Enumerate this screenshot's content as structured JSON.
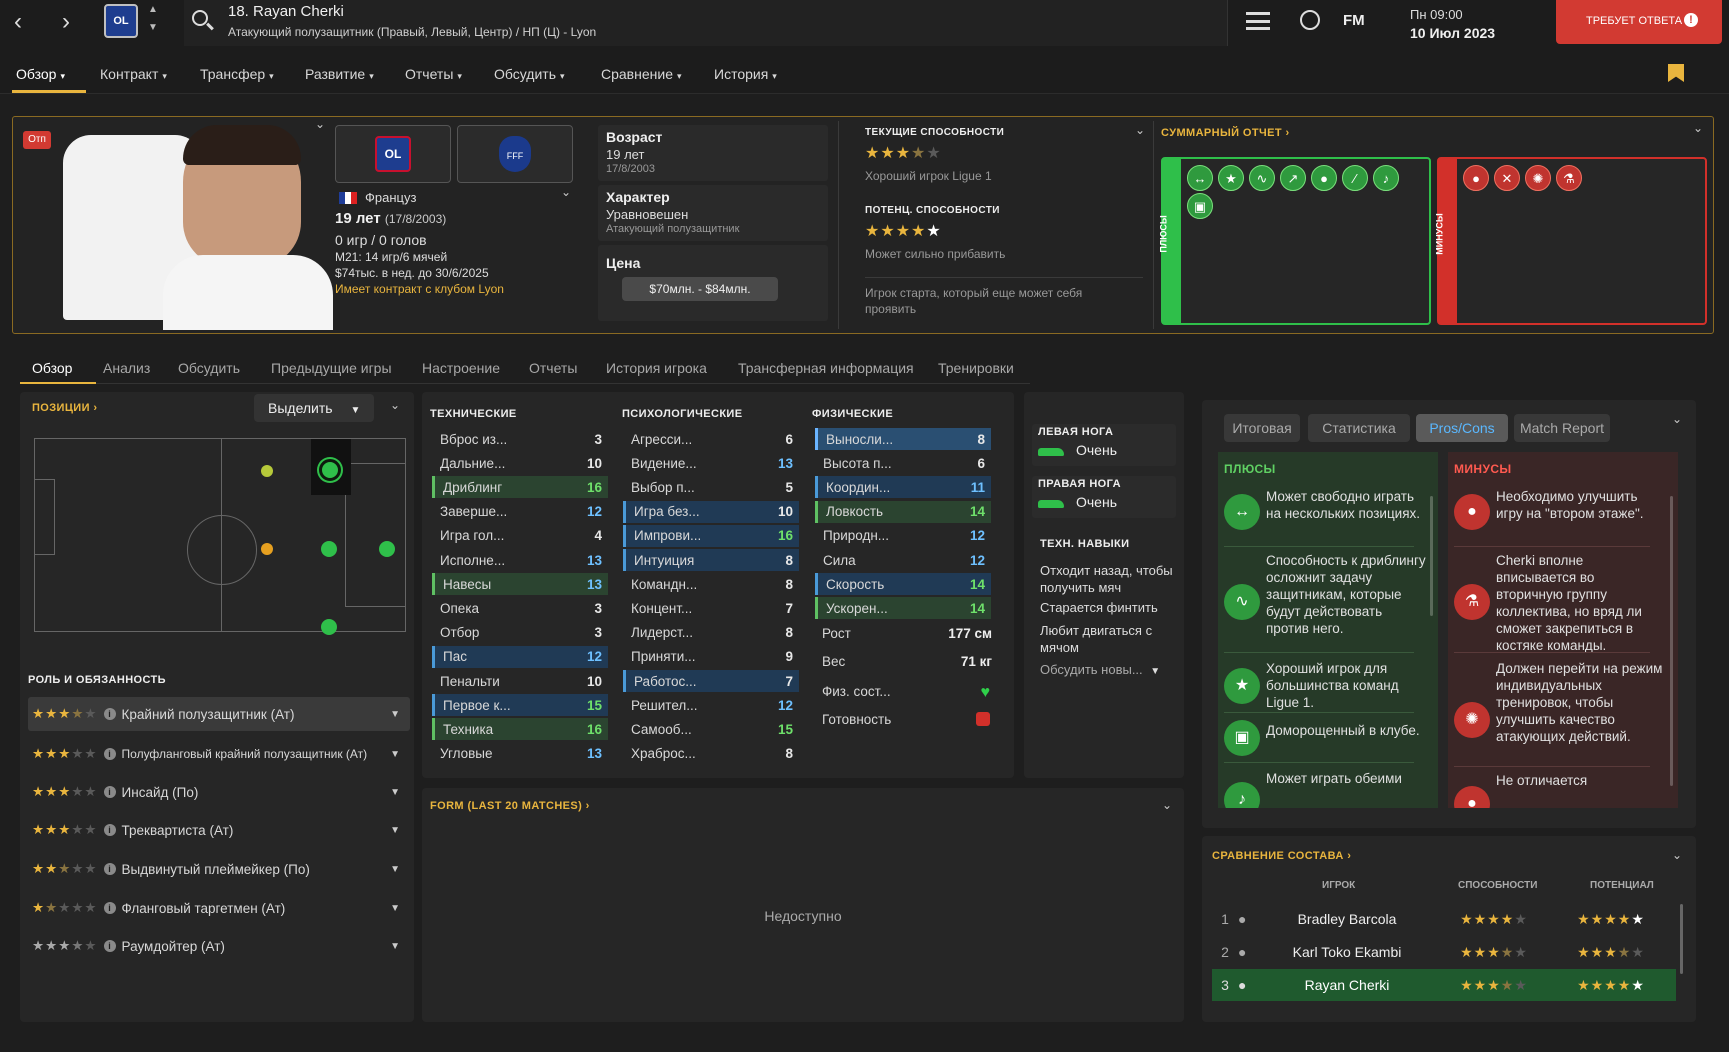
{
  "player": {
    "title": "18. Rayan Cherki",
    "subtitle": "Атакующий полузащитник (Правый, Левый, Центр) / НП (Ц) - Lyon",
    "nationality": "Француз",
    "age_line": "19 лет",
    "dob_paren": "(17/8/2003)",
    "games": "0 игр / 0 голов",
    "u21": "M21: 14 игр/6 мячей",
    "wage": "$74тыс. в нед. до 30/6/2025",
    "contract": "Имеет контракт с клубом Lyon",
    "loan_badge": "Отп",
    "club_badge": "OL",
    "nation_badge": "FFF"
  },
  "topbar": {
    "day_time": "Пн 09:00",
    "date": "10 Июл 2023",
    "fm_label": "FM",
    "alert_label": "ТРЕБУЕТ ОТВЕТА",
    "alert_mark": "!"
  },
  "nav": {
    "items": [
      "Обзор",
      "Контракт",
      "Трансфер",
      "Развитие",
      "Отчеты",
      "Обсудить",
      "Сравнение",
      "История"
    ]
  },
  "info": {
    "age_label": "Возраст",
    "age_value": "19 лет",
    "age_dob": "17/8/2003",
    "char_label": "Характер",
    "char_value": "Уравновешен",
    "char_role": "Атакующий полузащитник",
    "price_label": "Цена",
    "price_value": "$70млн. - $84млн."
  },
  "ability": {
    "ca_label": "ТЕКУЩИЕ СПОСОБНОСТИ",
    "ca_stars": 3.5,
    "ca_text": "Хороший игрок Ligue 1",
    "pa_label": "ПОТЕНЦ. СПОСОБНОСТИ",
    "pa_stars": 5,
    "pa_text": "Может сильно прибавить",
    "summary_text": "Игрок старта, который еще может себя проявить"
  },
  "summary": {
    "title": "СУММАРНЫЙ ОТЧЕТ",
    "plus_label": "ПЛЮСЫ",
    "minus_label": "МИНУСЫ",
    "plus_icons": 8,
    "minus_icons": 4
  },
  "subtabs": [
    "Обзор",
    "Анализ",
    "Обсудить",
    "Предыдущие игры",
    "Настроение",
    "Отчеты",
    "История игрока",
    "Трансферная информация",
    "Тренировки"
  ],
  "positions": {
    "title": "ПОЗИЦИИ",
    "highlight_label": "Выделить"
  },
  "roles": {
    "title": "РОЛЬ И ОБЯЗАННОСТЬ",
    "items": [
      {
        "name": "Крайний полузащитник (Ат)",
        "stars": 3.5
      },
      {
        "name": "Полуфланговый крайний полузащитник (Ат)",
        "stars": 3
      },
      {
        "name": "Инсайд (По)",
        "stars": 3
      },
      {
        "name": "Трекварти­ста (Ат)",
        "stars": 3
      },
      {
        "name": "Выдвинутый плеймейкер (По)",
        "stars": 2.5
      },
      {
        "name": "Фланговый таргетмен (Ат)",
        "stars": 1.5
      },
      {
        "name": "Раумдойтер (Ат)",
        "stars": 3.5
      }
    ]
  },
  "attributes": {
    "technical_title": "ТЕХНИЧЕСКИЕ",
    "mental_title": "ПСИХОЛОГИЧЕСКИЕ",
    "physical_title": "ФИЗИЧЕСКИЕ",
    "technical": [
      {
        "name": "Вброс из...",
        "value": "3",
        "hl": ""
      },
      {
        "name": "Дальние...",
        "value": "10",
        "hl": ""
      },
      {
        "name": "Дриблинг",
        "value": "16",
        "hl": "green"
      },
      {
        "name": "Заверше...",
        "value": "12",
        "hl": ""
      },
      {
        "name": "Игра гол...",
        "value": "4",
        "hl": ""
      },
      {
        "name": "Исполне...",
        "value": "13",
        "hl": ""
      },
      {
        "name": "Навесы",
        "value": "13",
        "hl": "green"
      },
      {
        "name": "Опека",
        "value": "3",
        "hl": ""
      },
      {
        "name": "Отбор",
        "value": "3",
        "hl": ""
      },
      {
        "name": "Пас",
        "value": "12",
        "hl": "blue"
      },
      {
        "name": "Пенальти",
        "value": "10",
        "hl": ""
      },
      {
        "name": "Первое к...",
        "value": "15",
        "hl": "blue"
      },
      {
        "name": "Техника",
        "value": "16",
        "hl": "green"
      },
      {
        "name": "Угловые",
        "value": "13",
        "hl": ""
      }
    ],
    "mental": [
      {
        "name": "Агресси...",
        "value": "6",
        "hl": ""
      },
      {
        "name": "Видение...",
        "value": "13",
        "hl": ""
      },
      {
        "name": "Выбор п...",
        "value": "5",
        "hl": ""
      },
      {
        "name": "Игра без...",
        "value": "10",
        "hl": "blue"
      },
      {
        "name": "Импрови...",
        "value": "16",
        "hl": "blue"
      },
      {
        "name": "Интуиция",
        "value": "8",
        "hl": "blue"
      },
      {
        "name": "Командн...",
        "value": "8",
        "hl": ""
      },
      {
        "name": "Концент...",
        "value": "7",
        "hl": ""
      },
      {
        "name": "Лидерст...",
        "value": "8",
        "hl": ""
      },
      {
        "name": "Приняти...",
        "value": "9",
        "hl": ""
      },
      {
        "name": "Работос...",
        "value": "7",
        "hl": "blue"
      },
      {
        "name": "Решител...",
        "value": "12",
        "hl": ""
      },
      {
        "name": "Самооб...",
        "value": "15",
        "hl": ""
      },
      {
        "name": "Храброс...",
        "value": "8",
        "hl": ""
      }
    ],
    "physical": [
      {
        "name": "Выносли...",
        "value": "8",
        "hl": "blue2"
      },
      {
        "name": "Высота п...",
        "value": "6",
        "hl": ""
      },
      {
        "name": "Координ...",
        "value": "11",
        "hl": "blue"
      },
      {
        "name": "Ловкость",
        "value": "14",
        "hl": "green"
      },
      {
        "name": "Природн...",
        "value": "12",
        "hl": ""
      },
      {
        "name": "Сила",
        "value": "12",
        "hl": ""
      },
      {
        "name": "Скорость",
        "value": "14",
        "hl": "blue"
      },
      {
        "name": "Ускорен...",
        "value": "14",
        "hl": "green"
      }
    ],
    "height_label": "Рост",
    "height_value": "177 см",
    "weight_label": "Вес",
    "weight_value": "71 кг",
    "condition_label": "Физ. сост...",
    "fitness_label": "Готовность"
  },
  "feet": {
    "left_label": "ЛЕВАЯ НОГА",
    "left_value": "Очень",
    "right_label": "ПРАВАЯ НОГА",
    "right_value": "Очень",
    "skills_label": "ТЕХН. НАВЫКИ",
    "skills": [
      "Отходит назад, чтобы получить мяч",
      "Старается финтить",
      "Любит двигаться с мячом"
    ],
    "discuss_new": "Обсудить новы..."
  },
  "form": {
    "title": "FORM (LAST 20 MATCHES)",
    "unavailable": "Недоступно"
  },
  "report_tabs": [
    "Итоговая",
    "Статистика",
    "Pros/Cons",
    "Match Report"
  ],
  "proscons": {
    "pros_title": "ПЛЮСЫ",
    "cons_title": "МИНУСЫ",
    "pros": [
      "Может свободно играть на нескольких позициях.",
      "Способность к дриблингу осложнит задачу защитникам, которые будут действовать против него.",
      "Хороший игрок для большинства команд Ligue 1.",
      "Доморощенный в клубе.",
      "Может играть обеими"
    ],
    "cons": [
      "Необходимо улучшить игру на \"втором этаже\".",
      "Cherki вполне вписывается во вторичную группу коллектива, но вряд ли сможет закрепиться в костяке команды.",
      "Должен перейти на режим индивидуальных тренировок, чтобы улучшить качество атакующих действий.",
      "Не отличается"
    ]
  },
  "squad": {
    "title": "СРАВНЕНИЕ СОСТАВА",
    "col_player": "ИГРОК",
    "col_ability": "СПОСОБНОСТИ",
    "col_potential": "ПОТЕНЦИАЛ",
    "rows": [
      {
        "rank": "1",
        "name": "Bradley Barcola",
        "ability": 4,
        "potential": 5
      },
      {
        "rank": "2",
        "name": "Karl Toko Ekambi",
        "ability": 3.5,
        "potential": 3.5
      },
      {
        "rank": "3",
        "name": "Rayan Cherki",
        "ability": 3.5,
        "potential": 5
      }
    ]
  },
  "colors": {
    "accent": "#e9b53e",
    "positive": "#2fbf4a",
    "negative": "#d2302a",
    "alert": "#d23a32"
  }
}
